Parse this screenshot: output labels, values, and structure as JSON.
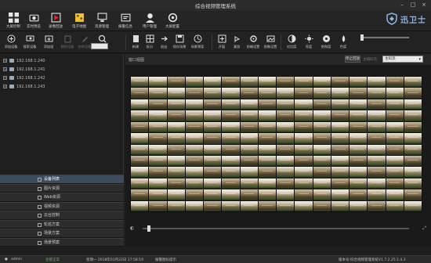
{
  "window": {
    "title": "综合视频管理系统"
  },
  "main_toolbar": [
    {
      "label": "大屏控制",
      "icon": "grid-icon"
    },
    {
      "label": "实时预览",
      "icon": "camera-icon"
    },
    {
      "label": "录像回放",
      "icon": "playback-icon"
    },
    {
      "label": "电子地图",
      "icon": "map-icon"
    },
    {
      "label": "资源管理",
      "icon": "monitor-icon"
    },
    {
      "label": "报警信息",
      "icon": "alarm-icon"
    },
    {
      "label": "用户管理",
      "icon": "user-icon"
    },
    {
      "label": "大屏配置",
      "icon": "wall-config-icon"
    }
  ],
  "brand": {
    "name": "迅卫士"
  },
  "sub_toolbar_left": [
    {
      "label": "添加设备",
      "dim": false
    },
    {
      "label": "搜索设备",
      "dim": false
    },
    {
      "label": "添加组",
      "dim": false
    },
    {
      "label": "删除设备",
      "dim": true
    },
    {
      "label": "修改设备",
      "dim": true
    }
  ],
  "sub_toolbar_right": [
    {
      "label": "新建"
    },
    {
      "label": "拆分"
    },
    {
      "label": "退出"
    },
    {
      "label": "保存场景"
    },
    {
      "label": "场景预案"
    },
    {
      "label": "开窗"
    },
    {
      "label": "漫游"
    },
    {
      "label": "前端设置"
    },
    {
      "label": "图像设置"
    },
    {
      "label": "对比度"
    },
    {
      "label": "亮度"
    },
    {
      "label": "饱和度"
    },
    {
      "label": "色度"
    }
  ],
  "devices": [
    "192.168.1.240",
    "192.168.1.241",
    "192.168.1.242",
    "192.168.1.243"
  ],
  "nav": [
    {
      "label": "设备列表",
      "active": true
    },
    {
      "label": "图片资源",
      "active": false
    },
    {
      "label": "Web资源",
      "active": false
    },
    {
      "label": "视频资源",
      "active": false
    },
    {
      "label": "云台控制",
      "active": false
    },
    {
      "label": "轮巡方案",
      "active": false
    },
    {
      "label": "场景方案",
      "active": false
    },
    {
      "label": "场景预案",
      "active": false
    }
  ],
  "video_area": {
    "label": "窗口视图",
    "stop_button": "停止回放",
    "stream_label": "主辅码流",
    "stream_select": "主码流"
  },
  "status": {
    "user": "admin",
    "state": "连接正常",
    "datetime": "星期一  2018年01月22日 17:58:19",
    "message": "报警图标提示",
    "version": "版本号:综合视频管理系统V1.7.2.25.1.4.3"
  }
}
